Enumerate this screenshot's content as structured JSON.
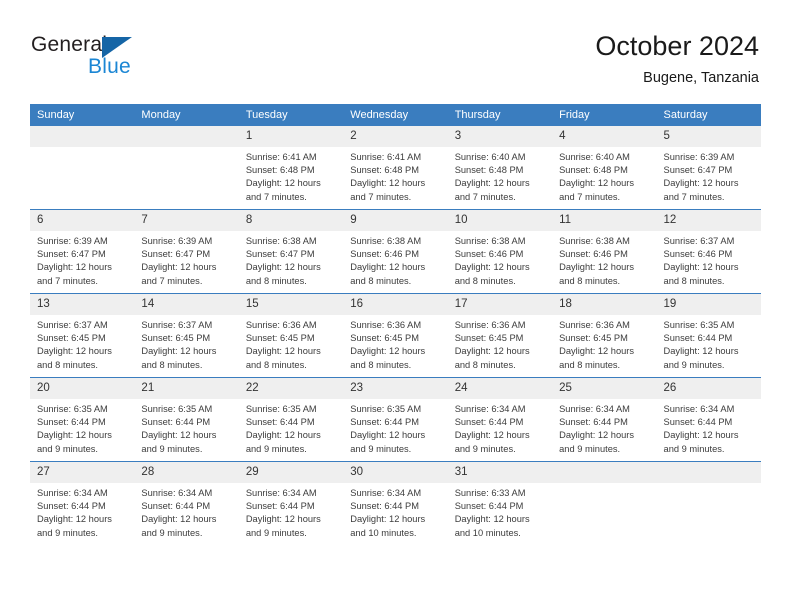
{
  "brand": {
    "name_line1": "General",
    "name_line2": "Blue",
    "triangle_color": "#1565a6",
    "blue_color": "#1b86d4"
  },
  "header": {
    "title": "October 2024",
    "subtitle": "Bugene, Tanzania"
  },
  "theme": {
    "header_bg": "#3a7dbf",
    "header_text": "#ffffff",
    "daynum_bg": "#efefef",
    "row_border": "#3a7dbf",
    "body_text": "#3c3c3c"
  },
  "weekdays": [
    "Sunday",
    "Monday",
    "Tuesday",
    "Wednesday",
    "Thursday",
    "Friday",
    "Saturday"
  ],
  "weeks": [
    [
      {
        "day": "",
        "sunrise": "",
        "sunset": "",
        "daylight1": "",
        "daylight2": "",
        "blank": true
      },
      {
        "day": "",
        "sunrise": "",
        "sunset": "",
        "daylight1": "",
        "daylight2": "",
        "blank": true
      },
      {
        "day": "1",
        "sunrise": "Sunrise: 6:41 AM",
        "sunset": "Sunset: 6:48 PM",
        "daylight1": "Daylight: 12 hours",
        "daylight2": "and 7 minutes."
      },
      {
        "day": "2",
        "sunrise": "Sunrise: 6:41 AM",
        "sunset": "Sunset: 6:48 PM",
        "daylight1": "Daylight: 12 hours",
        "daylight2": "and 7 minutes."
      },
      {
        "day": "3",
        "sunrise": "Sunrise: 6:40 AM",
        "sunset": "Sunset: 6:48 PM",
        "daylight1": "Daylight: 12 hours",
        "daylight2": "and 7 minutes."
      },
      {
        "day": "4",
        "sunrise": "Sunrise: 6:40 AM",
        "sunset": "Sunset: 6:48 PM",
        "daylight1": "Daylight: 12 hours",
        "daylight2": "and 7 minutes."
      },
      {
        "day": "5",
        "sunrise": "Sunrise: 6:39 AM",
        "sunset": "Sunset: 6:47 PM",
        "daylight1": "Daylight: 12 hours",
        "daylight2": "and 7 minutes."
      }
    ],
    [
      {
        "day": "6",
        "sunrise": "Sunrise: 6:39 AM",
        "sunset": "Sunset: 6:47 PM",
        "daylight1": "Daylight: 12 hours",
        "daylight2": "and 7 minutes."
      },
      {
        "day": "7",
        "sunrise": "Sunrise: 6:39 AM",
        "sunset": "Sunset: 6:47 PM",
        "daylight1": "Daylight: 12 hours",
        "daylight2": "and 7 minutes."
      },
      {
        "day": "8",
        "sunrise": "Sunrise: 6:38 AM",
        "sunset": "Sunset: 6:47 PM",
        "daylight1": "Daylight: 12 hours",
        "daylight2": "and 8 minutes."
      },
      {
        "day": "9",
        "sunrise": "Sunrise: 6:38 AM",
        "sunset": "Sunset: 6:46 PM",
        "daylight1": "Daylight: 12 hours",
        "daylight2": "and 8 minutes."
      },
      {
        "day": "10",
        "sunrise": "Sunrise: 6:38 AM",
        "sunset": "Sunset: 6:46 PM",
        "daylight1": "Daylight: 12 hours",
        "daylight2": "and 8 minutes."
      },
      {
        "day": "11",
        "sunrise": "Sunrise: 6:38 AM",
        "sunset": "Sunset: 6:46 PM",
        "daylight1": "Daylight: 12 hours",
        "daylight2": "and 8 minutes."
      },
      {
        "day": "12",
        "sunrise": "Sunrise: 6:37 AM",
        "sunset": "Sunset: 6:46 PM",
        "daylight1": "Daylight: 12 hours",
        "daylight2": "and 8 minutes."
      }
    ],
    [
      {
        "day": "13",
        "sunrise": "Sunrise: 6:37 AM",
        "sunset": "Sunset: 6:45 PM",
        "daylight1": "Daylight: 12 hours",
        "daylight2": "and 8 minutes."
      },
      {
        "day": "14",
        "sunrise": "Sunrise: 6:37 AM",
        "sunset": "Sunset: 6:45 PM",
        "daylight1": "Daylight: 12 hours",
        "daylight2": "and 8 minutes."
      },
      {
        "day": "15",
        "sunrise": "Sunrise: 6:36 AM",
        "sunset": "Sunset: 6:45 PM",
        "daylight1": "Daylight: 12 hours",
        "daylight2": "and 8 minutes."
      },
      {
        "day": "16",
        "sunrise": "Sunrise: 6:36 AM",
        "sunset": "Sunset: 6:45 PM",
        "daylight1": "Daylight: 12 hours",
        "daylight2": "and 8 minutes."
      },
      {
        "day": "17",
        "sunrise": "Sunrise: 6:36 AM",
        "sunset": "Sunset: 6:45 PM",
        "daylight1": "Daylight: 12 hours",
        "daylight2": "and 8 minutes."
      },
      {
        "day": "18",
        "sunrise": "Sunrise: 6:36 AM",
        "sunset": "Sunset: 6:45 PM",
        "daylight1": "Daylight: 12 hours",
        "daylight2": "and 8 minutes."
      },
      {
        "day": "19",
        "sunrise": "Sunrise: 6:35 AM",
        "sunset": "Sunset: 6:44 PM",
        "daylight1": "Daylight: 12 hours",
        "daylight2": "and 9 minutes."
      }
    ],
    [
      {
        "day": "20",
        "sunrise": "Sunrise: 6:35 AM",
        "sunset": "Sunset: 6:44 PM",
        "daylight1": "Daylight: 12 hours",
        "daylight2": "and 9 minutes."
      },
      {
        "day": "21",
        "sunrise": "Sunrise: 6:35 AM",
        "sunset": "Sunset: 6:44 PM",
        "daylight1": "Daylight: 12 hours",
        "daylight2": "and 9 minutes."
      },
      {
        "day": "22",
        "sunrise": "Sunrise: 6:35 AM",
        "sunset": "Sunset: 6:44 PM",
        "daylight1": "Daylight: 12 hours",
        "daylight2": "and 9 minutes."
      },
      {
        "day": "23",
        "sunrise": "Sunrise: 6:35 AM",
        "sunset": "Sunset: 6:44 PM",
        "daylight1": "Daylight: 12 hours",
        "daylight2": "and 9 minutes."
      },
      {
        "day": "24",
        "sunrise": "Sunrise: 6:34 AM",
        "sunset": "Sunset: 6:44 PM",
        "daylight1": "Daylight: 12 hours",
        "daylight2": "and 9 minutes."
      },
      {
        "day": "25",
        "sunrise": "Sunrise: 6:34 AM",
        "sunset": "Sunset: 6:44 PM",
        "daylight1": "Daylight: 12 hours",
        "daylight2": "and 9 minutes."
      },
      {
        "day": "26",
        "sunrise": "Sunrise: 6:34 AM",
        "sunset": "Sunset: 6:44 PM",
        "daylight1": "Daylight: 12 hours",
        "daylight2": "and 9 minutes."
      }
    ],
    [
      {
        "day": "27",
        "sunrise": "Sunrise: 6:34 AM",
        "sunset": "Sunset: 6:44 PM",
        "daylight1": "Daylight: 12 hours",
        "daylight2": "and 9 minutes."
      },
      {
        "day": "28",
        "sunrise": "Sunrise: 6:34 AM",
        "sunset": "Sunset: 6:44 PM",
        "daylight1": "Daylight: 12 hours",
        "daylight2": "and 9 minutes."
      },
      {
        "day": "29",
        "sunrise": "Sunrise: 6:34 AM",
        "sunset": "Sunset: 6:44 PM",
        "daylight1": "Daylight: 12 hours",
        "daylight2": "and 9 minutes."
      },
      {
        "day": "30",
        "sunrise": "Sunrise: 6:34 AM",
        "sunset": "Sunset: 6:44 PM",
        "daylight1": "Daylight: 12 hours",
        "daylight2": "and 10 minutes."
      },
      {
        "day": "31",
        "sunrise": "Sunrise: 6:33 AM",
        "sunset": "Sunset: 6:44 PM",
        "daylight1": "Daylight: 12 hours",
        "daylight2": "and 10 minutes."
      },
      {
        "day": "",
        "sunrise": "",
        "sunset": "",
        "daylight1": "",
        "daylight2": "",
        "blank": true
      },
      {
        "day": "",
        "sunrise": "",
        "sunset": "",
        "daylight1": "",
        "daylight2": "",
        "blank": true
      }
    ]
  ]
}
